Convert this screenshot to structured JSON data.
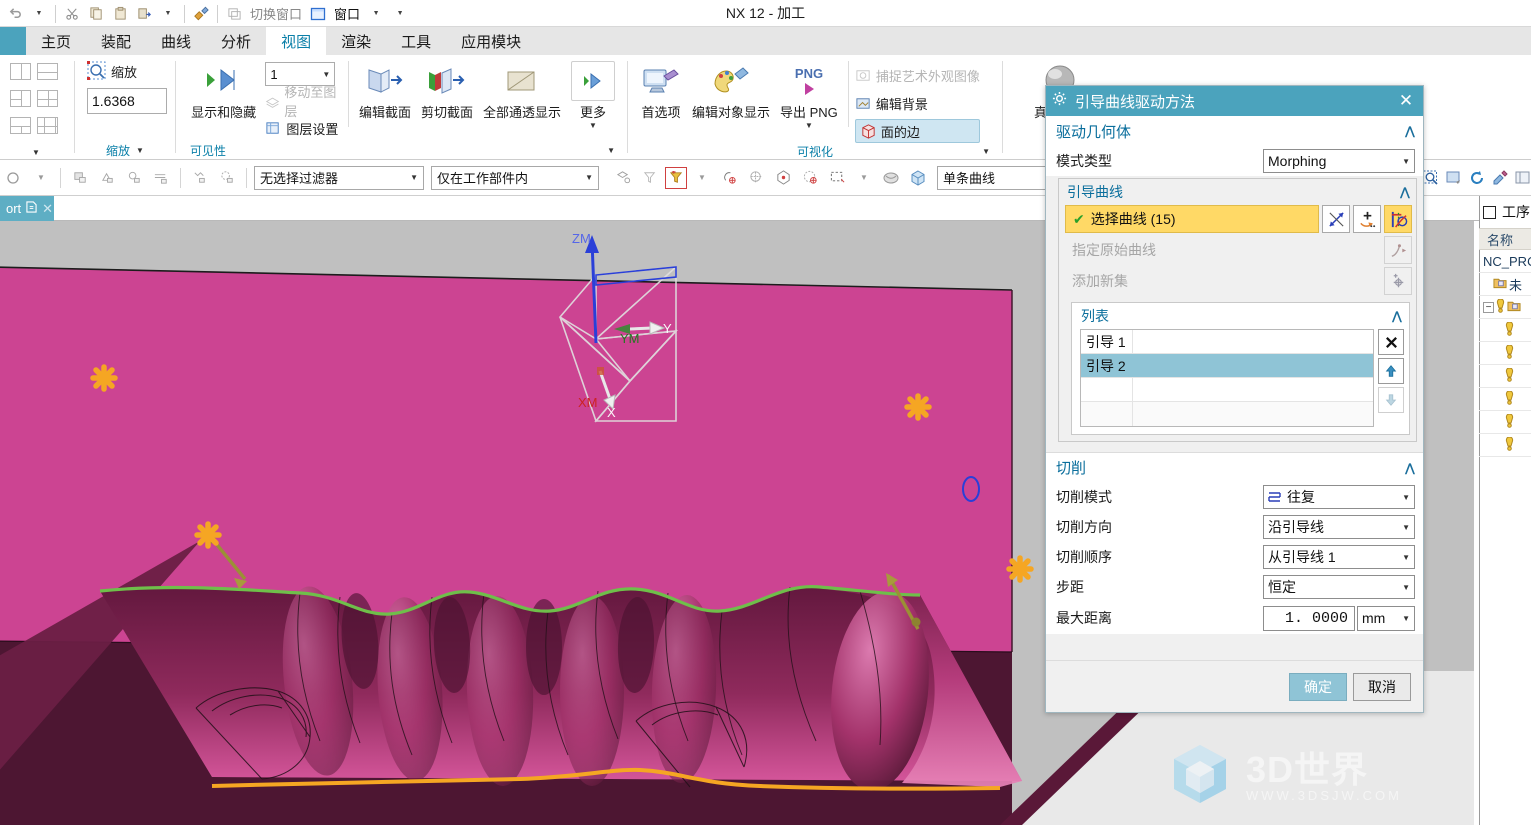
{
  "window": {
    "title": "NX 12 - 加工"
  },
  "quick_access": {
    "items": [
      {
        "name": "undo",
        "icon": "undo-arrow-icon",
        "label": ""
      },
      {
        "name": "undo-dropdown",
        "icon": "chevron-down-icon",
        "label": ""
      },
      {
        "name": "cut",
        "icon": "scissors-icon",
        "label": ""
      },
      {
        "name": "copy",
        "icon": "copy-icon",
        "label": ""
      },
      {
        "name": "paste",
        "icon": "clipboard-icon",
        "label": ""
      },
      {
        "name": "paste-special",
        "icon": "paste-special-icon",
        "label": ""
      },
      {
        "name": "paste-dropdown",
        "icon": "chevron-down-icon",
        "label": ""
      },
      {
        "name": "format-painter",
        "icon": "brush-icon",
        "label": ""
      },
      {
        "name": "switch-window",
        "icon": "switch-window-icon",
        "label": "切换窗口"
      },
      {
        "name": "window",
        "icon": "window-icon",
        "label": "窗口"
      },
      {
        "name": "window-dropdown",
        "icon": "chevron-down-icon",
        "label": ""
      },
      {
        "name": "more-qat",
        "icon": "chevron-down-double-icon",
        "label": ""
      }
    ]
  },
  "ribbon_tabs": [
    {
      "label": "主页",
      "active": false
    },
    {
      "label": "装配",
      "active": false
    },
    {
      "label": "曲线",
      "active": false
    },
    {
      "label": "分析",
      "active": false
    },
    {
      "label": "视图",
      "active": true
    },
    {
      "label": "渲染",
      "active": false
    },
    {
      "label": "工具",
      "active": false
    },
    {
      "label": "应用模块",
      "active": false
    }
  ],
  "ribbon": {
    "groups": [
      {
        "title": "",
        "name": "layout-group",
        "items": []
      },
      {
        "title": "缩放",
        "name": "zoom-group",
        "zoom_button_label": "缩放",
        "zoom_value": "1.6368"
      },
      {
        "title": "可见性",
        "name": "visibility-group",
        "show_hide_label": "显示和隐藏",
        "layer_combo_value": "1",
        "move_to_layer_label": "移动至图层",
        "layer_settings_label": "图层设置",
        "edit_section_label": "编辑截面",
        "clip_section_label": "剪切截面",
        "all_transparent_label": "全部通透显示",
        "more_label": "更多"
      },
      {
        "title": "可视化",
        "name": "visualization-group",
        "preferences_label": "首选项",
        "edit_object_display_label": "编辑对象显示",
        "export_png_label": "导出 PNG",
        "export_png_badge": "PNG",
        "capture_artistic_label": "捕捉艺术外观图像",
        "edit_background_label": "编辑背景",
        "face_edges_label": "面的边"
      },
      {
        "title": "",
        "name": "style-group",
        "realistic_shading_label": "真实着色"
      }
    ]
  },
  "selection_bar": {
    "filter_value": "无选择过滤器",
    "scope_value": "仅在工作部件内",
    "snap_value": "单条曲线",
    "left_icons": [
      "select-general-icon",
      "select-feature-icon",
      "select-point-icon",
      "select-edge-icon",
      "select-face-icon",
      "select-body-icon"
    ],
    "right_icons": [
      "snap-toggle-icon",
      "snap-filter-icon",
      "snap-point-icon",
      "snap-dropdown-icon",
      "snap-arc-center-icon",
      "snap-quadrant-icon",
      "snap-existing-point-icon",
      "snap-endpoint-icon",
      "select-rect-icon",
      "select-rect-dropdown-icon",
      "face-select-icon",
      "solid-select-icon"
    ]
  },
  "doc_tab": {
    "label": "ort",
    "modified_icon": "modified-icon",
    "close_icon": "close-icon"
  },
  "viewport": {
    "wcs_labels": {
      "zm": "ZM",
      "ym": "YM",
      "xm": "XM",
      "x": "X",
      "y": "Y"
    },
    "colors": {
      "background": "#c0c0c0",
      "part_top": "#cc4492",
      "part_cavity": "#7d2250",
      "part_dark_side": "#5a1838",
      "guide_curve_1": "#6fbf4a",
      "guide_curve_2": "#f5a623",
      "wcs_z": "#1f3fd0",
      "wcs_x": "#cc2222",
      "wcs_y": "#1f8a1f",
      "marker": "#f5a623"
    },
    "watermark": {
      "text": "3D世界",
      "url": "WWW.3DSJW.COM",
      "logo_icon": "cube-logo-icon"
    }
  },
  "right_toolbar": {
    "icons": [
      "zoom-find-icon",
      "pan-icon",
      "refresh-icon",
      "edit-object-icon",
      "panel-icon"
    ]
  },
  "resource_panel": {
    "header_label": "工序",
    "column_header": "名称",
    "rows": [
      {
        "label": "NC_PRO",
        "icon": "",
        "indent": 0
      },
      {
        "label": "未",
        "icon": "folder-icon",
        "indent": 1
      },
      {
        "label": "",
        "icon": "warn-folder-icon",
        "indent": 0,
        "expander": "-"
      },
      {
        "label": "",
        "icon": "warn-icon",
        "indent": 2
      },
      {
        "label": "",
        "icon": "warn-icon",
        "indent": 2
      },
      {
        "label": "",
        "icon": "warn-icon",
        "indent": 2
      },
      {
        "label": "",
        "icon": "warn-icon",
        "indent": 2
      },
      {
        "label": "",
        "icon": "warn-icon",
        "indent": 2
      },
      {
        "label": "",
        "icon": "warn-icon",
        "indent": 2
      }
    ]
  },
  "dialog": {
    "title": "引导曲线驱动方法",
    "title_icon": "gear-icon",
    "close_icon": "close-icon",
    "sections": {
      "drive_geometry": {
        "title": "驱动几何体",
        "collapse_icon": "chevron-up-icon",
        "mode_type_label": "模式类型",
        "mode_type_value": "Morphing",
        "guide_curves": {
          "title": "引导曲线",
          "collapse_icon": "chevron-up-icon",
          "select_curve_label": "选择曲线 (15)",
          "select_curve_check": "✔",
          "specify_original_curve_label": "指定原始曲线",
          "add_new_set_label": "添加新集",
          "buttons": [
            {
              "name": "intersect-curve-button",
              "icon": "intersection-curve-icon",
              "enabled": true
            },
            {
              "name": "add-curve-button",
              "icon": "add-curve-icon",
              "enabled": true
            },
            {
              "name": "curve-rule-button",
              "icon": "curve-rule-icon",
              "enabled": true,
              "highlighted": true
            },
            {
              "name": "specify-original-curve-button",
              "icon": "original-curve-icon",
              "enabled": false
            },
            {
              "name": "add-new-set-button",
              "icon": "add-set-icon",
              "enabled": false
            }
          ],
          "list": {
            "title": "列表",
            "collapse_icon": "chevron-up-icon",
            "rows": [
              {
                "label": "引导 1",
                "selected": false
              },
              {
                "label": "引导 2",
                "selected": true
              },
              {
                "label": "",
                "selected": false
              },
              {
                "label": "",
                "selected": false
              }
            ],
            "buttons": [
              {
                "name": "delete-button",
                "icon": "x-icon",
                "enabled": true
              },
              {
                "name": "move-up-button",
                "icon": "arrow-up-icon",
                "enabled": true
              },
              {
                "name": "move-down-button",
                "icon": "arrow-down-icon",
                "enabled": false
              }
            ]
          }
        }
      },
      "cutting": {
        "title": "切削",
        "collapse_icon": "chevron-up-icon",
        "fields": [
          {
            "label": "切削模式",
            "value": "往复",
            "icon": "zigzag-icon",
            "type": "combo",
            "name": "cut-pattern"
          },
          {
            "label": "切削方向",
            "value": "沿引导线",
            "icon": "",
            "type": "combo",
            "name": "cut-direction"
          },
          {
            "label": "切削顺序",
            "value": "从引导线 1",
            "icon": "",
            "type": "combo",
            "name": "cut-order"
          },
          {
            "label": "步距",
            "value": "恒定",
            "icon": "",
            "type": "combo",
            "name": "stepover"
          }
        ],
        "max_distance_label": "最大距离",
        "max_distance_value": "1. 0000",
        "max_distance_unit": "mm"
      }
    },
    "footer": {
      "ok_label": "确定",
      "cancel_label": "取消"
    }
  }
}
